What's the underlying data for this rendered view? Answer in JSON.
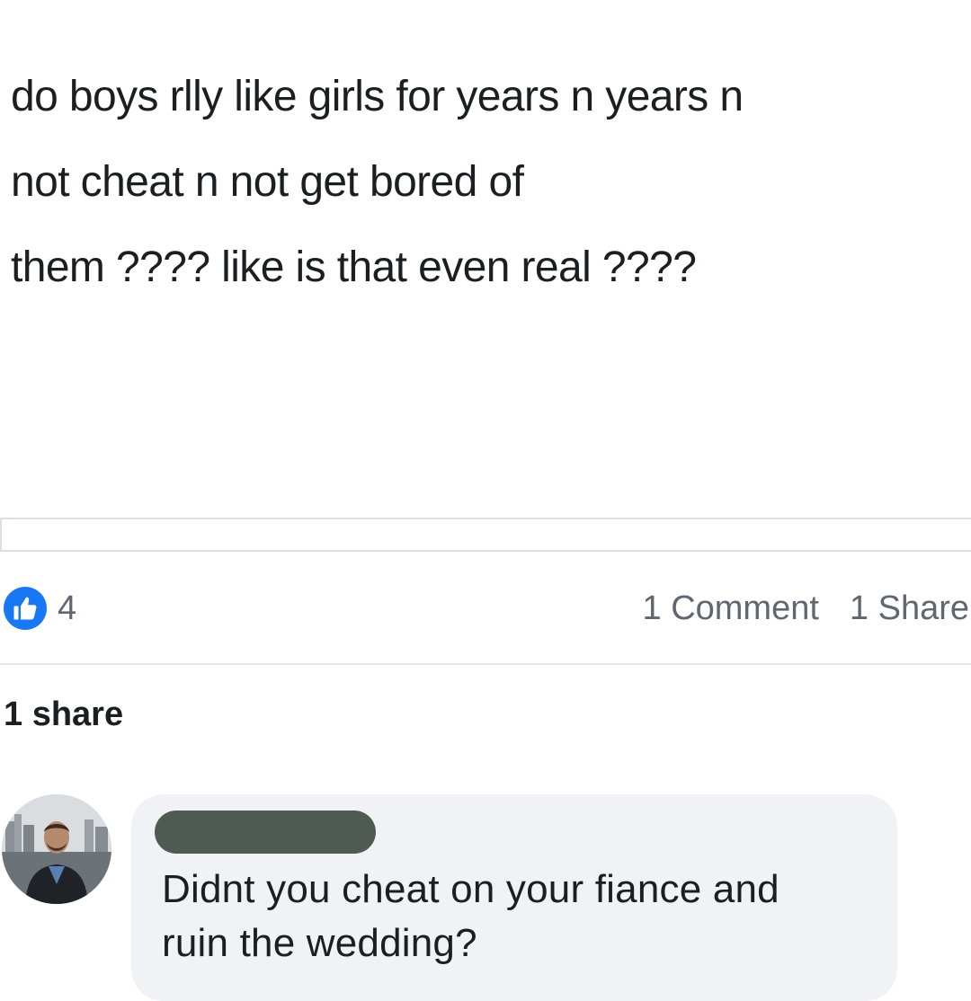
{
  "post": {
    "lines": [
      "do boys rlly like girls for years n years n",
      "not cheat n not get bored of",
      "them ???? like is that even real ????"
    ]
  },
  "reactions": {
    "like_count": "4",
    "comments_label": "1 Comment",
    "shares_label": "1 Share",
    "like_color": "#1877f2"
  },
  "share_note": "1 share",
  "comment": {
    "avatar_icon": "profile-photo",
    "lines": [
      "Didnt you cheat on your fiance and",
      "ruin the wedding?"
    ]
  }
}
